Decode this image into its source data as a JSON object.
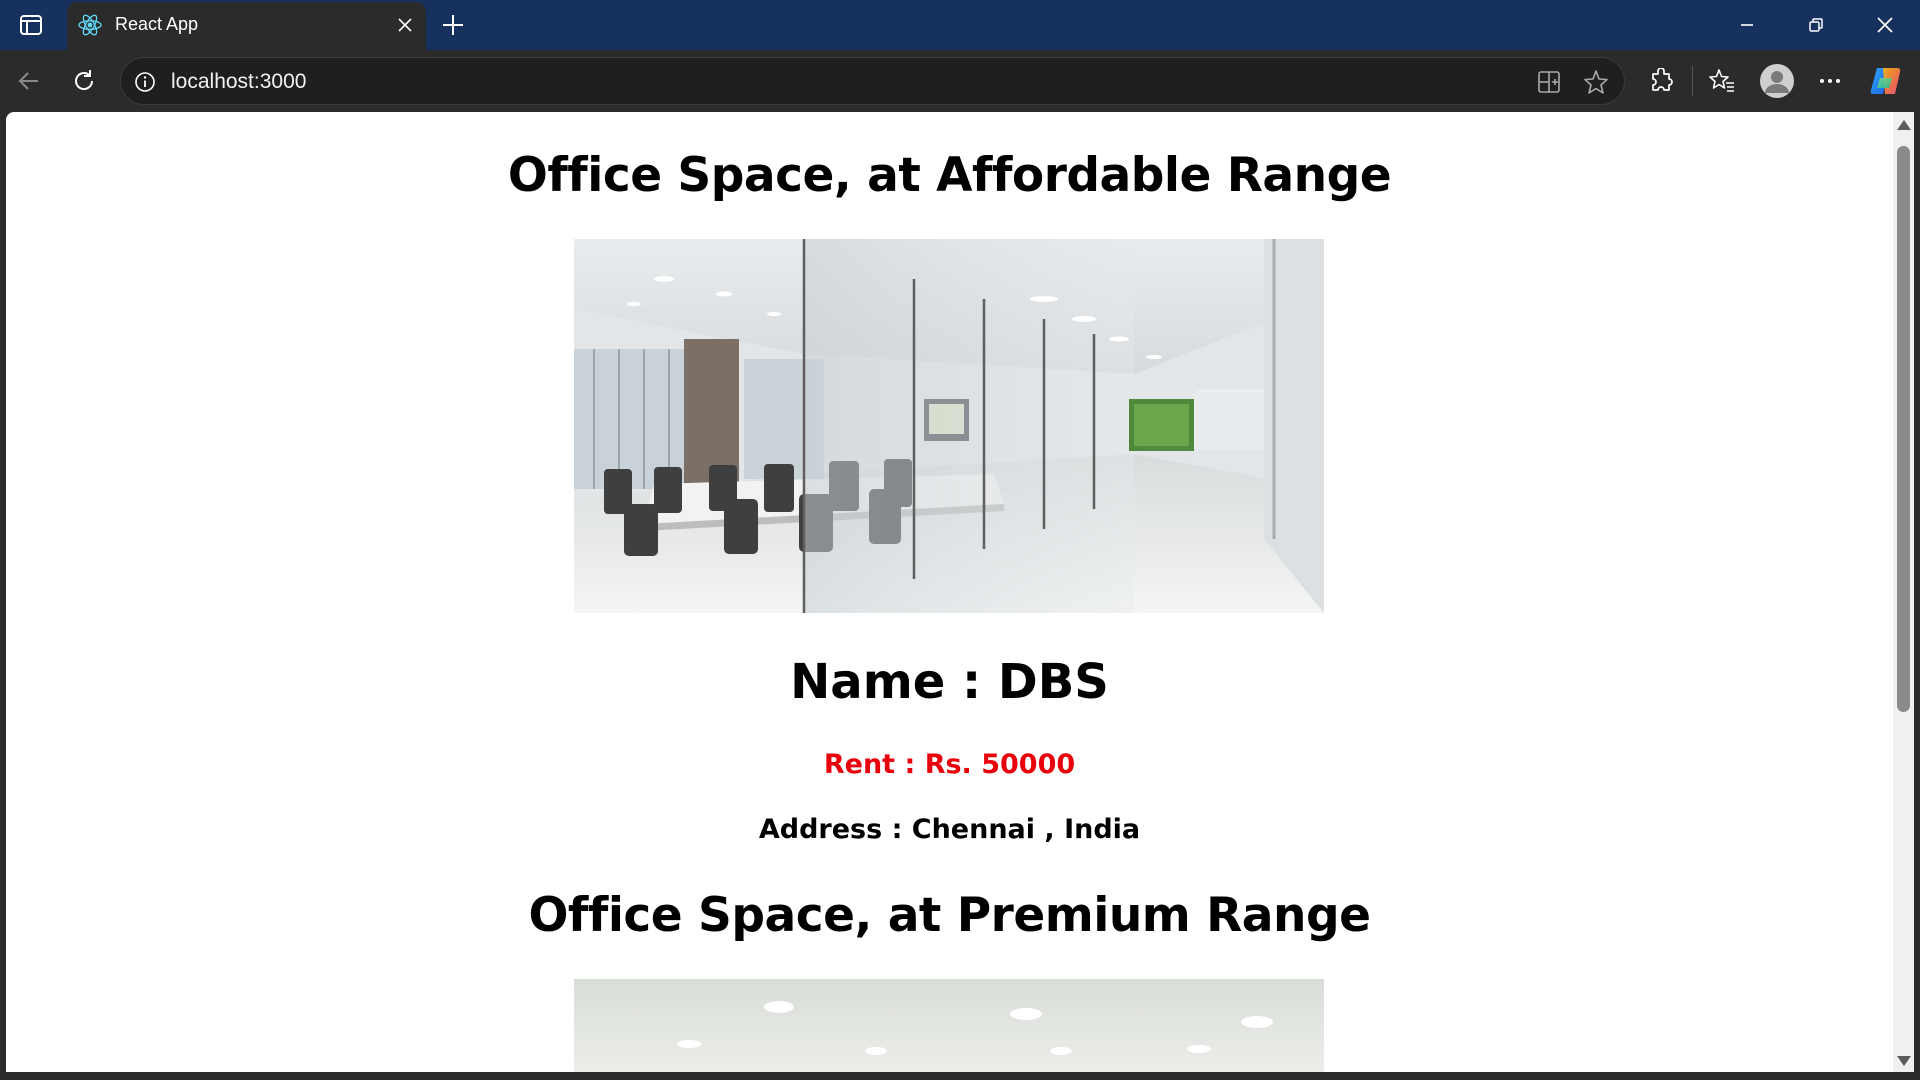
{
  "browser": {
    "tab_title": "React App",
    "url": "localhost:3000"
  },
  "colors": {
    "tabstrip": "#17315f",
    "toolbar": "#2b2b2b",
    "rent": "#e8000b"
  },
  "icons": [
    "sidebar-toggle-icon",
    "react-favicon-icon",
    "close-icon",
    "plus-icon",
    "minimize-icon",
    "restore-icon",
    "window-close-icon",
    "back-icon",
    "reload-icon",
    "info-icon",
    "app-available-icon",
    "favorite-star-icon",
    "extensions-icon",
    "favorites-icon",
    "profile-icon",
    "more-icon",
    "copilot-icon"
  ],
  "page": {
    "listings": [
      {
        "heading": "Office Space, at Affordable Range",
        "name": "Name : DBS",
        "rent": "Rent : Rs. 50000",
        "address": "Address : Chennai , India"
      },
      {
        "heading": "Office Space, at Premium Range"
      }
    ]
  }
}
